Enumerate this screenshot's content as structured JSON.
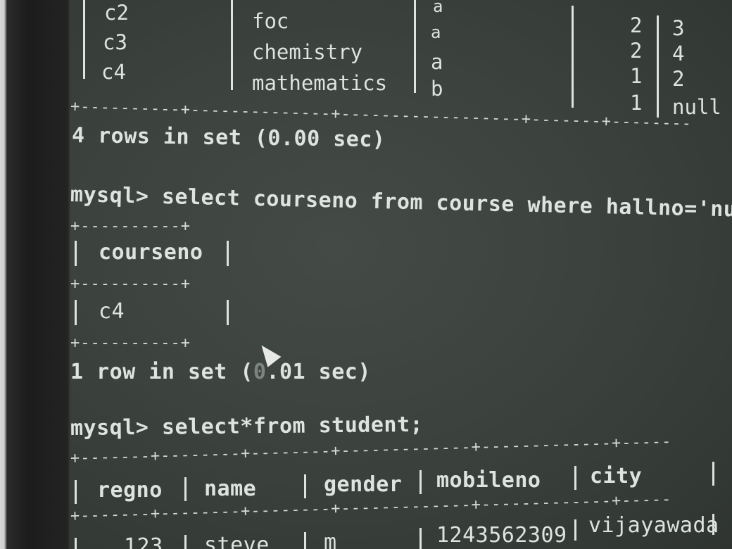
{
  "top_table": {
    "rows": [
      {
        "course": "c2",
        "name": "foc",
        "grade": "a",
        "n1": "2",
        "n2": "3"
      },
      {
        "course": "c3",
        "name": "chemistry",
        "grade": "a",
        "n1": "2",
        "n2": "4"
      },
      {
        "course": "c4",
        "name": "mathematics",
        "grade": "b",
        "n1": "1",
        "n2": "2"
      },
      {
        "course": "",
        "name": "",
        "grade": "b",
        "n1": "1",
        "n2": "null"
      }
    ],
    "partial_top_grade": "a",
    "footer": "4 rows in set (0.00 sec)"
  },
  "query2": {
    "prompt": "mysql>",
    "command": "select courseno from course where hallno='null'",
    "header": "courseno",
    "value": "c4",
    "footer_prefix": "1 row in set ",
    "footer_suffix": ".01 sec)"
  },
  "query3": {
    "prompt": "mysql>",
    "command": "select*from student;",
    "headers": [
      "regno",
      "name",
      "gender",
      "mobileno",
      "city"
    ],
    "row": {
      "regno": "123",
      "name": "steve",
      "gender": "m",
      "mobileno": "1243562309",
      "city": "vijayawada"
    }
  },
  "colors": {
    "screen_bg": "#3c423e",
    "text": "#dfe3df"
  }
}
